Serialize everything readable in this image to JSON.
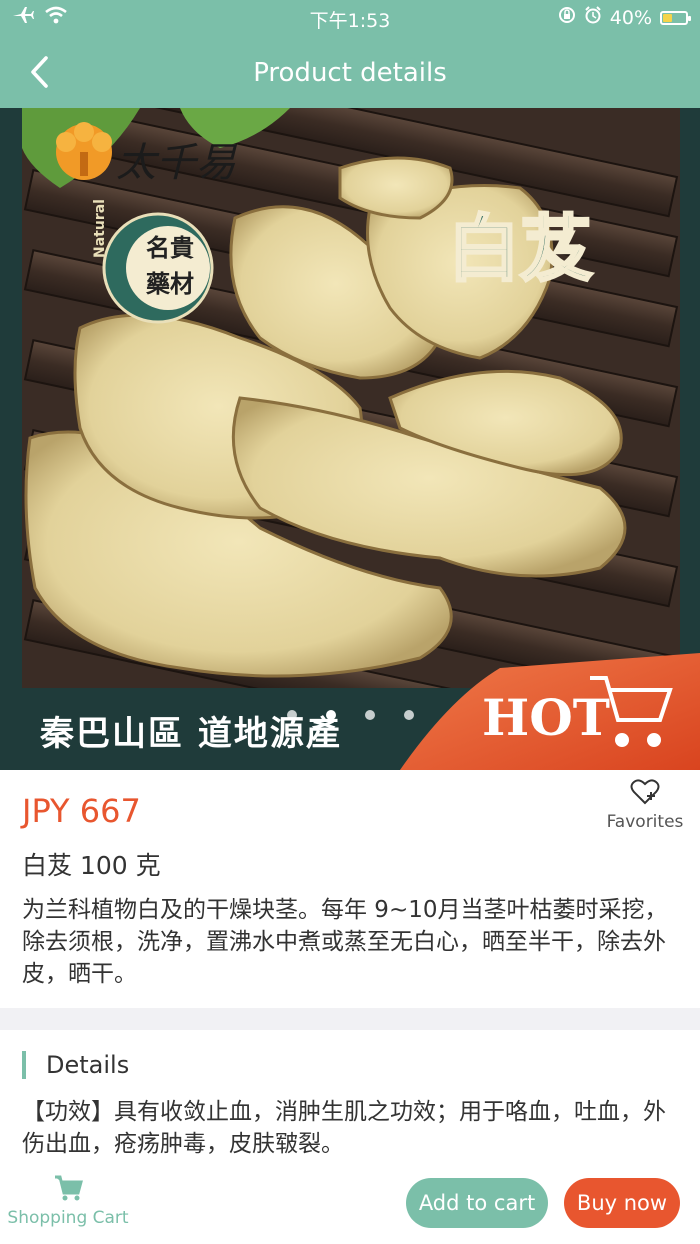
{
  "status_bar": {
    "time": "下午1:53",
    "battery": "40%",
    "battery_level": 0.4
  },
  "nav": {
    "title": "Product details",
    "back_icon": "chevron-left-icon"
  },
  "hero": {
    "logo_text": "太千易",
    "badge_lines": [
      "名貴",
      "藥材"
    ],
    "badge_side": "Natural",
    "product_title": "白芨",
    "banner_text": "秦巴山區 道地源產",
    "hot_text": "HOT",
    "carousel_total": 4,
    "carousel_active": 1,
    "colors": {
      "teal_dark": "#1f3b3a",
      "orange": "#e8562f",
      "accent": "#7bbfa9"
    }
  },
  "product": {
    "price": "JPY 667",
    "favorites_label": "Favorites",
    "name": "白芨 100 克",
    "description": "为兰科植物白及的干燥块茎。每年 9~10月当茎叶枯萎时采挖，除去须根，洗净，置沸水中煮或蒸至无白心，晒至半干，除去外皮，晒干。"
  },
  "details": {
    "heading": "Details",
    "body": "【功效】具有收敛止血，消肿生肌之功效；用于咯血，吐血，外伤出血，疮疡肿毒，皮肤皲裂。"
  },
  "footer": {
    "cart_label": "Shopping Cart",
    "add_to_cart": "Add to cart",
    "buy_now": "Buy now"
  }
}
